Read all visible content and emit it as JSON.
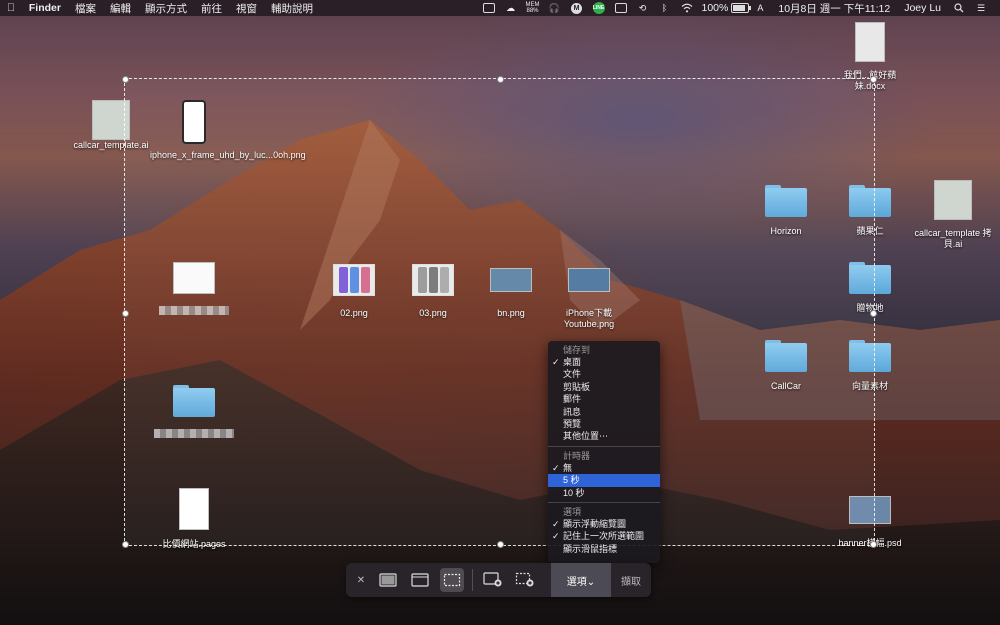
{
  "menubar": {
    "apple_icon": "apple-icon",
    "app_name": "Finder",
    "menus": [
      "檔案",
      "編輯",
      "顯示方式",
      "前往",
      "視窗",
      "輔助說明"
    ],
    "mem_label": "MEM",
    "mem_value": "88%",
    "line_label": "LINE",
    "m_label": "M",
    "battery": "100%",
    "datetime": "10月8日 週一 下午11:12",
    "user": "Joey Lu"
  },
  "desktop": {
    "callcar_ai_left": "callcar_template.ai",
    "iphone_frame": "iphone_x_frame_uhd_by_luc...0oh.png",
    "png_02": "02.png",
    "png_03": "03.png",
    "png_bn": "bn.png",
    "iphone_youtube": "iPhone下載Youtube.png",
    "pages_file": "比價網站.pages",
    "docx_file": "我們...館好蘋妹.docx",
    "horizon": "Horizon",
    "apple_folder": "蘋果仁",
    "gift_folder": "贈物地",
    "callcar_folder": "CallCar",
    "vector_folder": "向量素材",
    "callcar_ai_right": "callcar_template 拷貝.ai",
    "banner_psd": "banner橫幅.psd"
  },
  "options_menu": {
    "save_header": "儲存到",
    "save_items": [
      {
        "label": "桌面",
        "checked": true
      },
      {
        "label": "文件",
        "checked": false
      },
      {
        "label": "剪貼板",
        "checked": false
      },
      {
        "label": "郵件",
        "checked": false
      },
      {
        "label": "訊息",
        "checked": false
      },
      {
        "label": "預覽",
        "checked": false
      },
      {
        "label": "其他位置⋯",
        "checked": false
      }
    ],
    "timer_header": "計時器",
    "timer_items": [
      {
        "label": "無",
        "checked": true
      },
      {
        "label": "5 秒",
        "checked": false,
        "selected": true
      },
      {
        "label": "10 秒",
        "checked": false
      }
    ],
    "options_header": "選項",
    "option_items": [
      {
        "label": "顯示浮動縮覽圖",
        "checked": true
      },
      {
        "label": "記住上一次所選範圍",
        "checked": true
      },
      {
        "label": "顯示滑鼠指標",
        "checked": false
      }
    ]
  },
  "toolbar": {
    "options_label": "選項⌄",
    "capture_label": "擷取"
  },
  "colors": {
    "menu_highlight": "#2f63d8",
    "folder_blue": "#6cb6e6"
  }
}
